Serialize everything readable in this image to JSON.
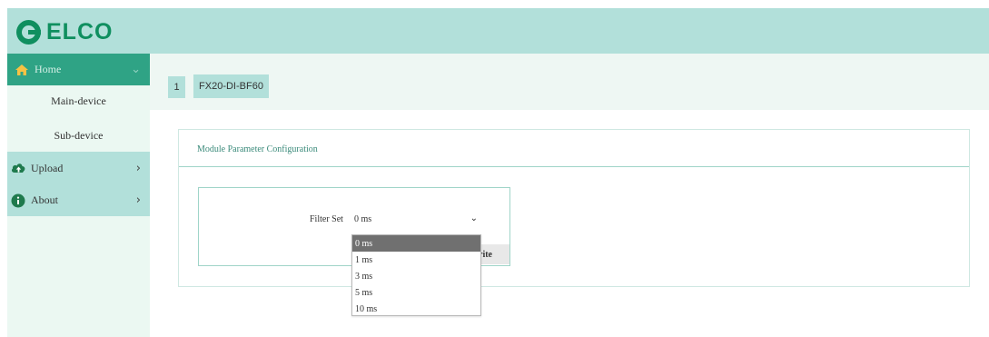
{
  "header": {
    "logo_text": "ELCO"
  },
  "sidebar": {
    "home": {
      "label": "Home",
      "icon": "home-icon",
      "expanded": true
    },
    "sub_items": [
      {
        "label": "Main-device"
      },
      {
        "label": "Sub-device"
      }
    ],
    "items": [
      {
        "label": "Upload",
        "icon": "cloud-upload-icon"
      },
      {
        "label": "About",
        "icon": "info-icon"
      }
    ]
  },
  "tabs": {
    "number": "1",
    "device": "FX20-DI-BF60"
  },
  "card": {
    "title": "Module Parameter Configuration"
  },
  "form": {
    "filter_label": "Filter Set",
    "filter_value": "0 ms",
    "write_label": "rite",
    "options": [
      "0 ms",
      "1 ms",
      "3 ms",
      "5 ms",
      "10 ms"
    ],
    "selected_option": "0 ms"
  },
  "colors": {
    "header": "#b2e0da",
    "active_nav": "#2fa385",
    "brand": "#0f8f5f",
    "accent_border": "#9fd4c8"
  }
}
